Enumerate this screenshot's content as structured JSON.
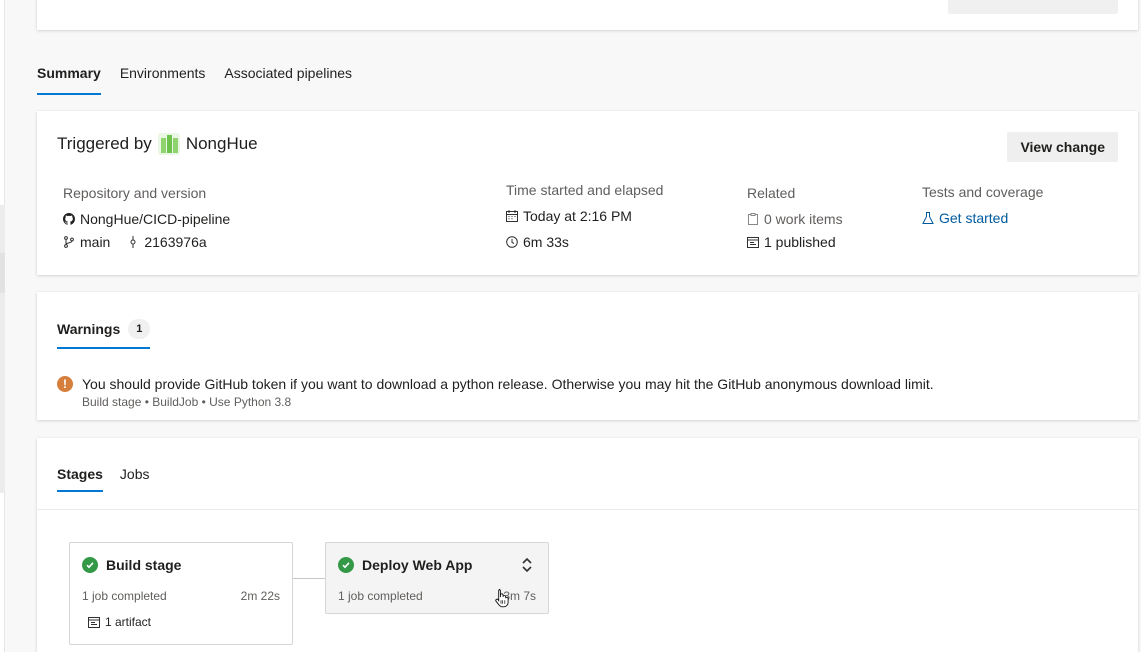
{
  "tabs": [
    {
      "label": "Summary",
      "active": true
    },
    {
      "label": "Environments",
      "active": false
    },
    {
      "label": "Associated pipelines",
      "active": false
    }
  ],
  "summary": {
    "triggered_prefix": "Triggered by",
    "user": "NongHue",
    "view_change": "View change",
    "repository": {
      "label": "Repository and version",
      "repo": "NongHue/CICD-pipeline",
      "branch": "main",
      "commit": "2163976a"
    },
    "time": {
      "label": "Time started and elapsed",
      "started": "Today at 2:16 PM",
      "elapsed": "6m 33s"
    },
    "related": {
      "label": "Related",
      "work_items": "0 work items",
      "published": "1 published"
    },
    "tests": {
      "label": "Tests and coverage",
      "link": "Get started"
    }
  },
  "warnings": {
    "tab_label": "Warnings",
    "count": "1",
    "items": [
      {
        "message": "You should provide GitHub token if you want to download a python release. Otherwise you may hit the GitHub anonymous download limit.",
        "source": "Build stage • BuildJob • Use Python 3.8"
      }
    ]
  },
  "stages_section": {
    "tabs": [
      {
        "label": "Stages",
        "active": true
      },
      {
        "label": "Jobs",
        "active": false
      }
    ],
    "stages": [
      {
        "name": "Build stage",
        "status": "1 job completed",
        "duration": "2m 22s",
        "artifact": "1 artifact"
      },
      {
        "name": "Deploy Web App",
        "status": "1 job completed",
        "duration": "3m 7s"
      }
    ]
  },
  "colors": {
    "accent": "#0078d4",
    "link": "#005a9e",
    "success": "#339947",
    "warning": "#d67f3c"
  }
}
